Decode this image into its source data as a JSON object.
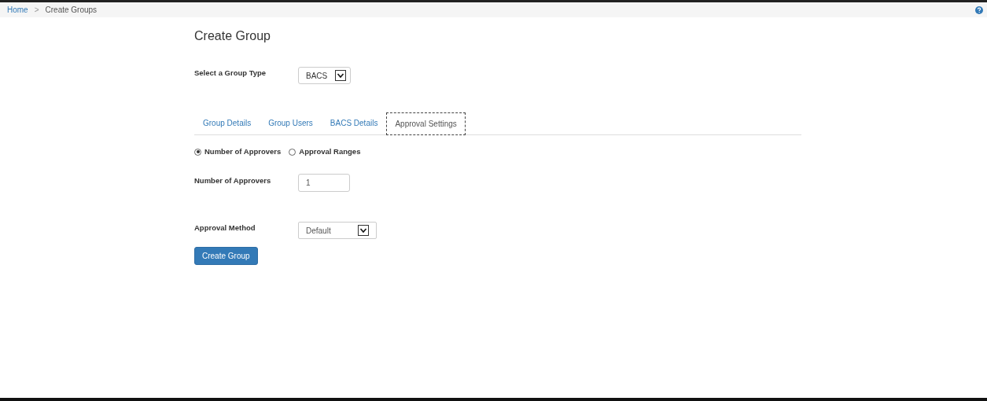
{
  "breadcrumb": [
    {
      "label": "Home",
      "kind": "link"
    },
    {
      "label": ">",
      "kind": "separator"
    },
    {
      "label": "Create Groups",
      "kind": "current"
    }
  ],
  "title": "Create Group",
  "group_type": {
    "label": "Select a Group Type",
    "value": "BACS"
  },
  "tabs": [
    {
      "label": "Group Details",
      "selected": false
    },
    {
      "label": "Group Users",
      "selected": false
    },
    {
      "label": "BACS Details",
      "selected": false
    },
    {
      "label": "Approval Settings",
      "selected": true
    }
  ],
  "approval_modes": [
    {
      "label": "Number of Approvers",
      "selected": true
    },
    {
      "label": "Approval Ranges",
      "selected": false
    }
  ],
  "approvers": {
    "label": "Number of Approvers",
    "value": "1"
  },
  "approval_method": {
    "label": "Approval Method",
    "value": "Default"
  },
  "submit": "Create Group"
}
